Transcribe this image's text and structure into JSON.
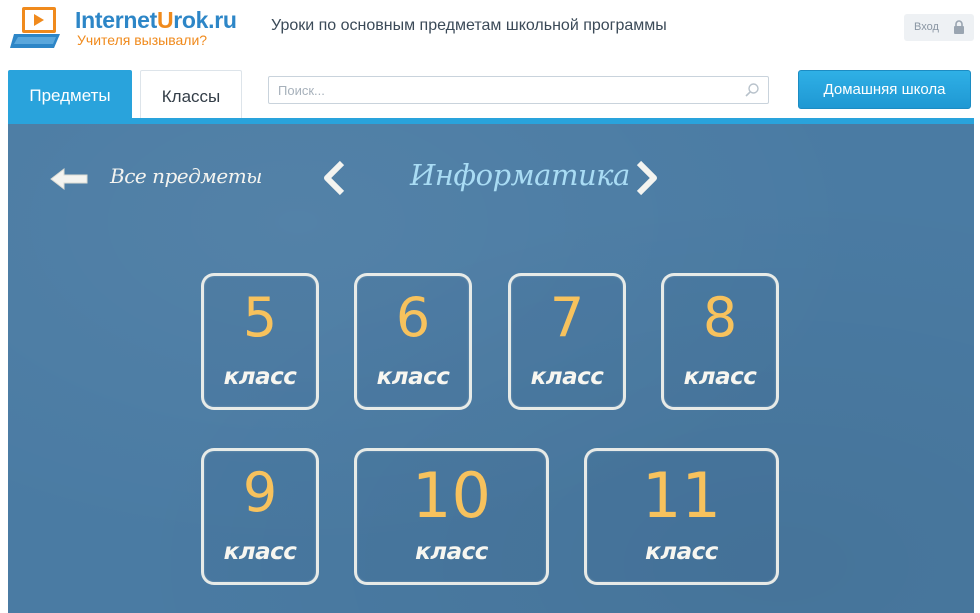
{
  "header": {
    "logo_name_prefix": "Internet",
    "logo_name_u": "U",
    "logo_name_suffix": "rok.ru",
    "logo_tagline": "Учителя вызывали?",
    "tagline": "Уроки по основным предметам школьной программы",
    "login_label": "Вход",
    "icons": {
      "logo": "laptop-play-icon",
      "lock": "lock-icon"
    }
  },
  "nav": {
    "tabs": [
      {
        "label": "Предметы",
        "active": true
      },
      {
        "label": "Классы",
        "active": false
      }
    ],
    "search_placeholder": "Поиск...",
    "search_icon": "search-icon",
    "home_button": "Домашняя школа"
  },
  "board": {
    "back_label": "Все предметы",
    "subject_title": "Информатика",
    "icons": {
      "back": "arrow-left-icon",
      "prev": "chevron-left-icon",
      "next": "chevron-right-icon"
    },
    "grades": [
      {
        "number": "5",
        "label": "класс"
      },
      {
        "number": "6",
        "label": "класс"
      },
      {
        "number": "7",
        "label": "класс"
      },
      {
        "number": "8",
        "label": "класс"
      },
      {
        "number": "9",
        "label": "класс"
      },
      {
        "number": "10",
        "label": "класс"
      },
      {
        "number": "11",
        "label": "класс"
      }
    ]
  },
  "colors": {
    "brand_blue": "#29a3dc",
    "brand_orange": "#f08a1c",
    "board": "#4a7ba3",
    "chalk_yellow": "#f7c25d",
    "title_blue": "#a9dcf4"
  }
}
